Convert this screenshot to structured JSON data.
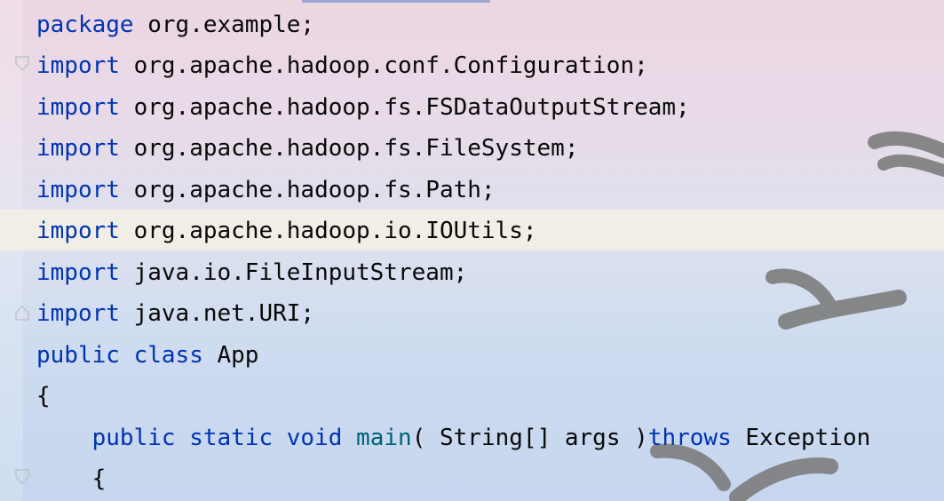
{
  "editor": {
    "lines": [
      {
        "kw": "package",
        "rest": " org.example;"
      },
      {
        "kw": "import",
        "rest": " org.apache.hadoop.conf.Configuration;"
      },
      {
        "kw": "import",
        "rest": " org.apache.hadoop.fs.FSDataOutputStream;"
      },
      {
        "kw": "import",
        "rest": " org.apache.hadoop.fs.FileSystem;"
      },
      {
        "kw": "import",
        "rest": " org.apache.hadoop.fs.Path;"
      },
      {
        "kw": "import",
        "rest": " org.apache.hadoop.io.IOUtils;"
      },
      {
        "kw": "import",
        "rest": " java.io.FileInputStream;"
      },
      {
        "kw": "import",
        "rest": " java.net.URI;"
      },
      {
        "kw": "public",
        "kw2": " class",
        "rest": " App"
      },
      {
        "rest": "{"
      },
      {
        "indent": "    ",
        "kw": "public",
        "kw2": " static",
        "kw3": " void",
        "fn": " main",
        "rest": "( String[] args )",
        "kw4": "throws",
        "rest2": " Exception"
      },
      {
        "indent": "    ",
        "rest": "{"
      }
    ],
    "current_line_index": 5,
    "colors": {
      "keyword": "#0033b3",
      "method": "#00627a",
      "text": "#080808",
      "current_line": "#f5f0e4"
    }
  }
}
